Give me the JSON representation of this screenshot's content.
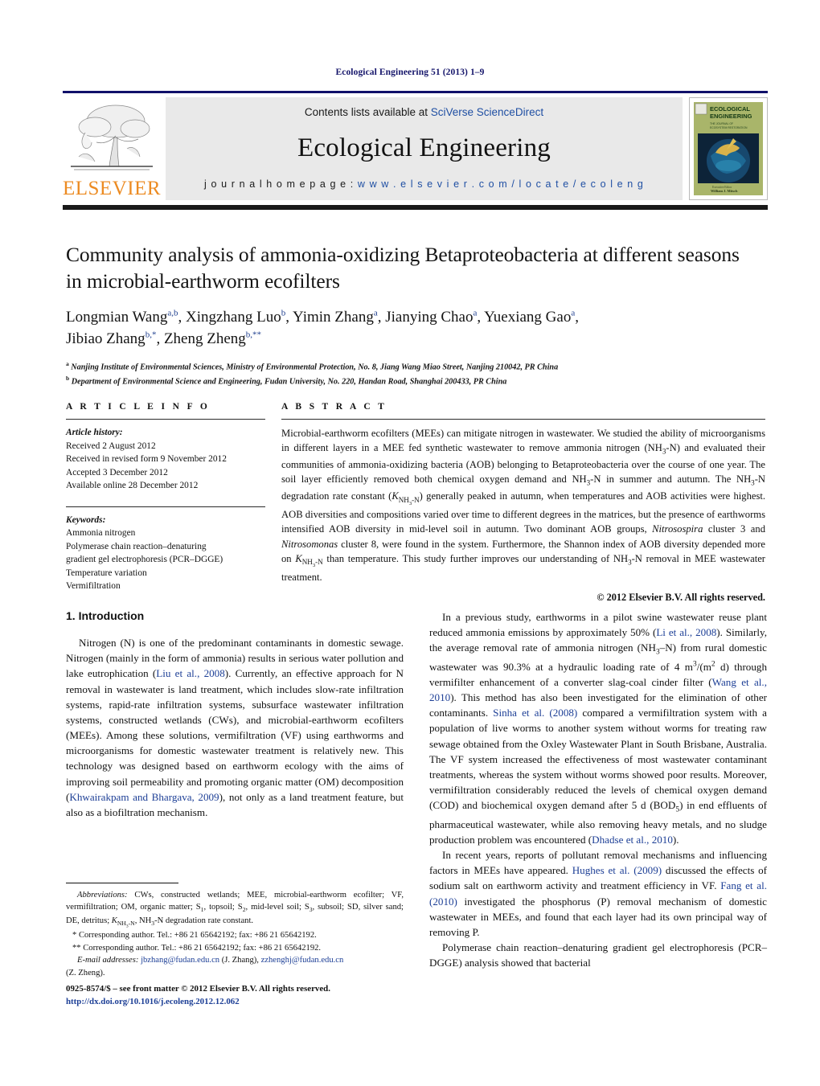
{
  "running_head": "Ecological Engineering 51 (2013) 1–9",
  "masthead": {
    "contents_prefix": "Contents lists available at ",
    "contents_link": "SciVerse ScienceDirect",
    "journal_name": "Ecological Engineering",
    "homepage_prefix": "j o u r n a l   h o m e p a g e :  ",
    "homepage_url": "w w w . e l s e v i e r . c o m / l o c a t e / e c o l e n g",
    "publisher_wordmark": "ELSEVIER",
    "cover_title_line1": "ECOLOGICAL",
    "cover_title_line2": "ENGINEERING",
    "colors": {
      "rule_navy": "#10106a",
      "rule_black": "#1a1a1a",
      "panel_grey": "#e9e9e9",
      "elsevier_orange": "#ec8b22",
      "link_blue": "#1f4fa3"
    }
  },
  "article": {
    "title": "Community analysis of ammonia-oxidizing Betaproteobacteria at different seasons in microbial-earthworm ecofilters",
    "authors_line1": "Longmian Wang",
    "authors": [
      {
        "name": "Longmian Wang",
        "marks": "a,b"
      },
      {
        "name": "Xingzhang Luo",
        "marks": "b"
      },
      {
        "name": "Yimin Zhang",
        "marks": "a"
      },
      {
        "name": "Jianying Chao",
        "marks": "a"
      },
      {
        "name": "Yuexiang Gao",
        "marks": "a"
      },
      {
        "name": "Jibiao Zhang",
        "marks": "b,*"
      },
      {
        "name": "Zheng Zheng",
        "marks": "b,**"
      }
    ],
    "affiliations": [
      {
        "mark": "a",
        "text": "Nanjing Institute of Environmental Sciences, Ministry of Environmental Protection, No. 8, Jiang Wang Miao Street, Nanjing 210042, PR China"
      },
      {
        "mark": "b",
        "text": "Department of Environmental Science and Engineering, Fudan University, No. 220, Handan Road, Shanghai 200433, PR China"
      }
    ]
  },
  "article_info": {
    "heading": "A R T I C L E    I N F O",
    "history_label": "Article history:",
    "history": [
      "Received 2 August 2012",
      "Received in revised form 9 November 2012",
      "Accepted 3 December 2012",
      "Available online 28 December 2012"
    ],
    "keywords_label": "Keywords:",
    "keywords": [
      "Ammonia nitrogen",
      "Polymerase chain reaction–denaturing",
      "gradient gel electrophoresis (PCR–DGGE)",
      "Temperature variation",
      "Vermifiltration"
    ]
  },
  "abstract": {
    "heading": "A B S T R A C T",
    "copyright": "© 2012 Elsevier B.V. All rights reserved."
  },
  "introduction": {
    "heading": "1.  Introduction"
  },
  "footnotes": {
    "abbrev_label": "Abbreviations:",
    "corresponding_1": "* Corresponding author. Tel.: +86 21 65642192; fax: +86 21 65642192.",
    "corresponding_2": "** Corresponding author. Tel.: +86 21 65642192; fax: +86 21 65642192.",
    "email_label": "E-mail addresses:",
    "email_1": "jbzhang@fudan.edu.cn",
    "email_1_owner": "(J. Zhang),",
    "email_2": "zzhenghj@fudan.edu.cn",
    "email_2_owner": "(Z. Zheng)."
  },
  "colophon": {
    "issn_line": "0925-8574/$ – see front matter © 2012 Elsevier B.V. All rights reserved.",
    "doi": "http://dx.doi.org/10.1016/j.ecoleng.2012.12.062"
  }
}
